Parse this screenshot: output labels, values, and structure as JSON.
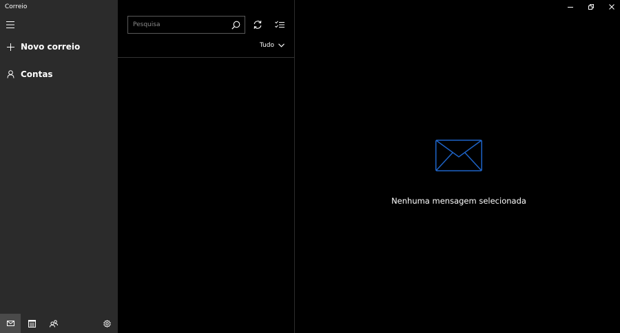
{
  "window": {
    "title": "Correio"
  },
  "sidebar": {
    "items": [
      {
        "label": "Novo correio",
        "icon": "plus-icon"
      },
      {
        "label": "Contas",
        "icon": "person-icon"
      }
    ],
    "bottom_icons": [
      "mail-icon",
      "calendar-icon",
      "people-icon",
      "gear-icon"
    ]
  },
  "list": {
    "search_placeholder": "Pesquisa",
    "filter_label": "Tudo"
  },
  "reading": {
    "empty_message": "Nenhuma mensagem selecionada"
  },
  "colors": {
    "sidebar_bg": "#2b2b2b",
    "pane_bg": "#000000",
    "accent": "#1e64c8"
  }
}
